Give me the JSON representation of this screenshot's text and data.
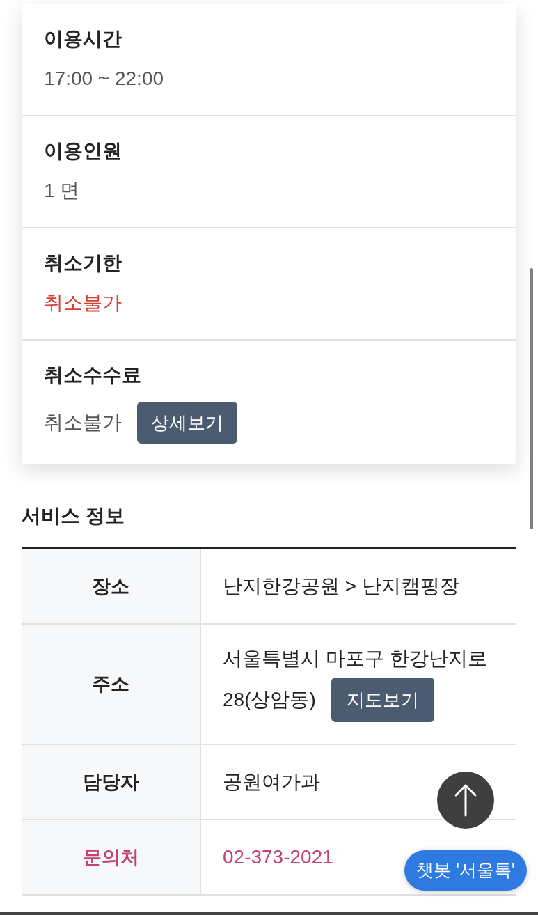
{
  "booking_details": [
    {
      "label": "이용시간",
      "value": "17:00 ~ 22:00",
      "warning": false
    },
    {
      "label": "이용인원",
      "value": "1 면",
      "warning": false
    },
    {
      "label": "취소기한",
      "value": "취소불가",
      "warning": true
    },
    {
      "label": "취소수수료",
      "value": "취소불가",
      "warning": false,
      "button": "상세보기"
    }
  ],
  "service_info": {
    "title": "서비스 정보",
    "rows": [
      {
        "header": "장소",
        "value_lines": [
          "난지한강공원 > 난지캠핑장"
        ],
        "highlighted": false
      },
      {
        "header": "주소",
        "value_lines": [
          "서울특별시 마포구 한강난지로",
          "28(상암동)"
        ],
        "highlighted": false,
        "button": "지도보기"
      },
      {
        "header": "담당자",
        "value_lines": [
          "공원여가과"
        ],
        "highlighted": false
      },
      {
        "header": "문의처",
        "value_lines": [
          "02-373-2021"
        ],
        "highlighted": true
      }
    ]
  },
  "chatbot_button": {
    "label": "챗봇 '서울톡'"
  }
}
